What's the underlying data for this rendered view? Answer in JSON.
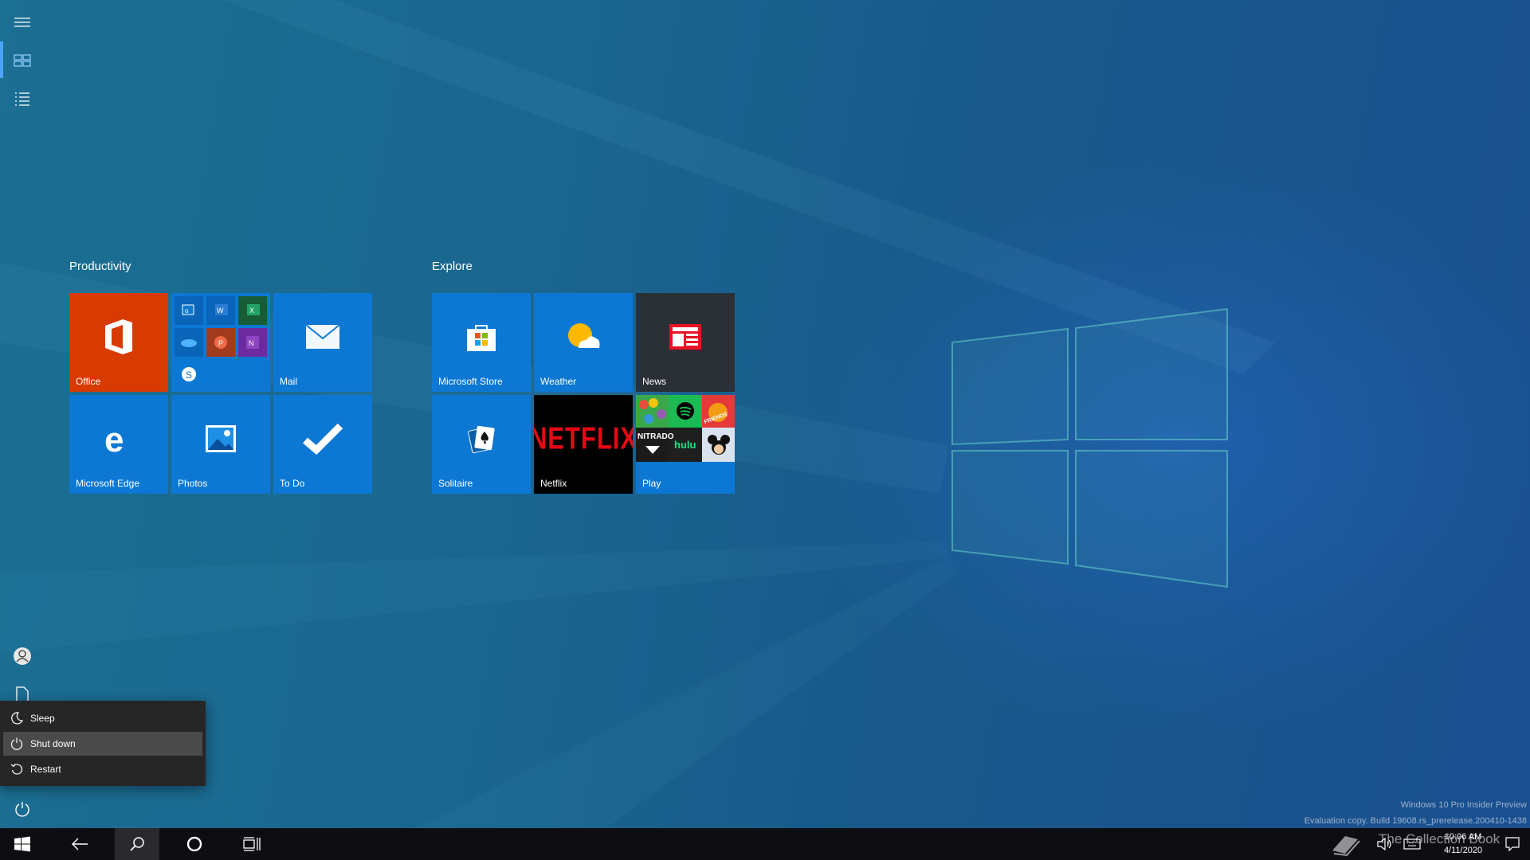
{
  "rail": {
    "items": [
      {
        "name": "hamburger-menu-icon"
      },
      {
        "name": "tiles-view-icon"
      },
      {
        "name": "all-apps-list-icon"
      },
      {
        "name": "user-account-icon"
      },
      {
        "name": "documents-icon"
      },
      {
        "name": "power-icon"
      }
    ]
  },
  "groups": [
    {
      "title": "Productivity",
      "tiles": [
        {
          "label": "Office",
          "color": "#d83b01",
          "icon": "office-icon"
        },
        {
          "label": "",
          "color": "#0c78d4",
          "icon": "office-apps-folder-icon"
        },
        {
          "label": "Mail",
          "color": "#0c78d4",
          "icon": "mail-icon"
        },
        {
          "label": "Microsoft Edge",
          "color": "#0c78d4",
          "icon": "edge-icon"
        },
        {
          "label": "Photos",
          "color": "#0c78d4",
          "icon": "photos-icon"
        },
        {
          "label": "To Do",
          "color": "#0c78d4",
          "icon": "todo-check-icon"
        }
      ]
    },
    {
      "title": "Explore",
      "tiles": [
        {
          "label": "Microsoft Store",
          "color": "#0c78d4",
          "icon": "store-bag-icon"
        },
        {
          "label": "Weather",
          "color": "#0c78d4",
          "icon": "weather-sun-cloud-icon"
        },
        {
          "label": "News",
          "color": "#2b2f36",
          "icon": "news-icon"
        },
        {
          "label": "Solitaire",
          "color": "#0c78d4",
          "icon": "solitaire-cards-icon"
        },
        {
          "label": "Netflix",
          "color": "#000000",
          "icon": "netflix-logo",
          "logo_text": "NETFLIX"
        },
        {
          "label": "Play",
          "color": "#0c78d4",
          "icon": "play-folder-icon"
        }
      ]
    }
  ],
  "play_folder": {
    "nitrado": "NITRADO",
    "hulu": "hulu",
    "friends": "FRIENDS"
  },
  "power_menu": {
    "items": [
      {
        "label": "Sleep",
        "icon": "moon-icon"
      },
      {
        "label": "Shut down",
        "icon": "power-icon",
        "highlighted": true
      },
      {
        "label": "Restart",
        "icon": "restart-icon"
      }
    ]
  },
  "taskbar": {
    "time": "10:06 AM",
    "date": "4/11/2020"
  },
  "watermark": {
    "line1": "Windows 10 Pro Insider Preview",
    "line2": "Evaluation copy. Build 19608.rs_prerelease.200410-1438",
    "overlay": "The Collection Book"
  }
}
